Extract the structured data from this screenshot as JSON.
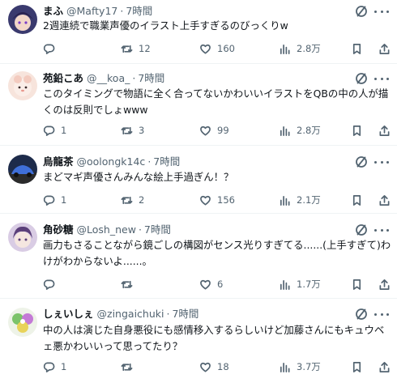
{
  "colors": {
    "text_primary": "#0f1419",
    "text_secondary": "#536471",
    "divider": "#eff3f4",
    "background": "#ffffff"
  },
  "icons": {
    "reply": "speech-bubble-icon",
    "retweet": "retweet-arrows-icon",
    "like": "heart-icon",
    "views": "bar-chart-icon",
    "bookmark": "bookmark-icon",
    "share": "share-upload-icon",
    "grok": "grok-slash-circle-icon",
    "more": "ellipsis-icon"
  },
  "tweets": [
    {
      "name": "まふ",
      "handle": "@Mafty17",
      "separator": "·",
      "time": "7時間",
      "text": "2週連続で職業声優のイラスト上手すぎるのびっくりw",
      "replies": "",
      "retweets": "12",
      "likes": "160",
      "views": "2.8万"
    },
    {
      "name": "苑鉛こあ",
      "handle": "@__koa_",
      "separator": "·",
      "time": "7時間",
      "text": "このタイミングで物語に全く合ってないかわいいイラストをQBの中の人が描くのは反則でしょwww",
      "replies": "1",
      "retweets": "3",
      "likes": "99",
      "views": "2.8万"
    },
    {
      "name": "烏龍茶",
      "handle": "@oolongk14c",
      "separator": "·",
      "time": "7時間",
      "text": "まどマギ声優さんみんな絵上手過ぎん！？",
      "replies": "1",
      "retweets": "2",
      "likes": "156",
      "views": "2.1万"
    },
    {
      "name": "角砂糖",
      "handle": "@Losh_new",
      "separator": "·",
      "time": "7時間",
      "text": "画力もさることながら鏡ごしの構図がセンス光りすぎてる......(上手すぎて)わけがわからないよ......。",
      "replies": "",
      "retweets": "",
      "likes": "6",
      "views": "1.7万"
    },
    {
      "name": "しぇいしぇ",
      "handle": "@zingaichuki",
      "separator": "·",
      "time": "7時間",
      "text": "中の人は演じた自身悪役にも感情移入するらしいけど加藤さんにもキュウベェ悪かわいいって思ってたり？",
      "replies": "1",
      "retweets": "",
      "likes": "18",
      "views": "3.7万"
    }
  ]
}
